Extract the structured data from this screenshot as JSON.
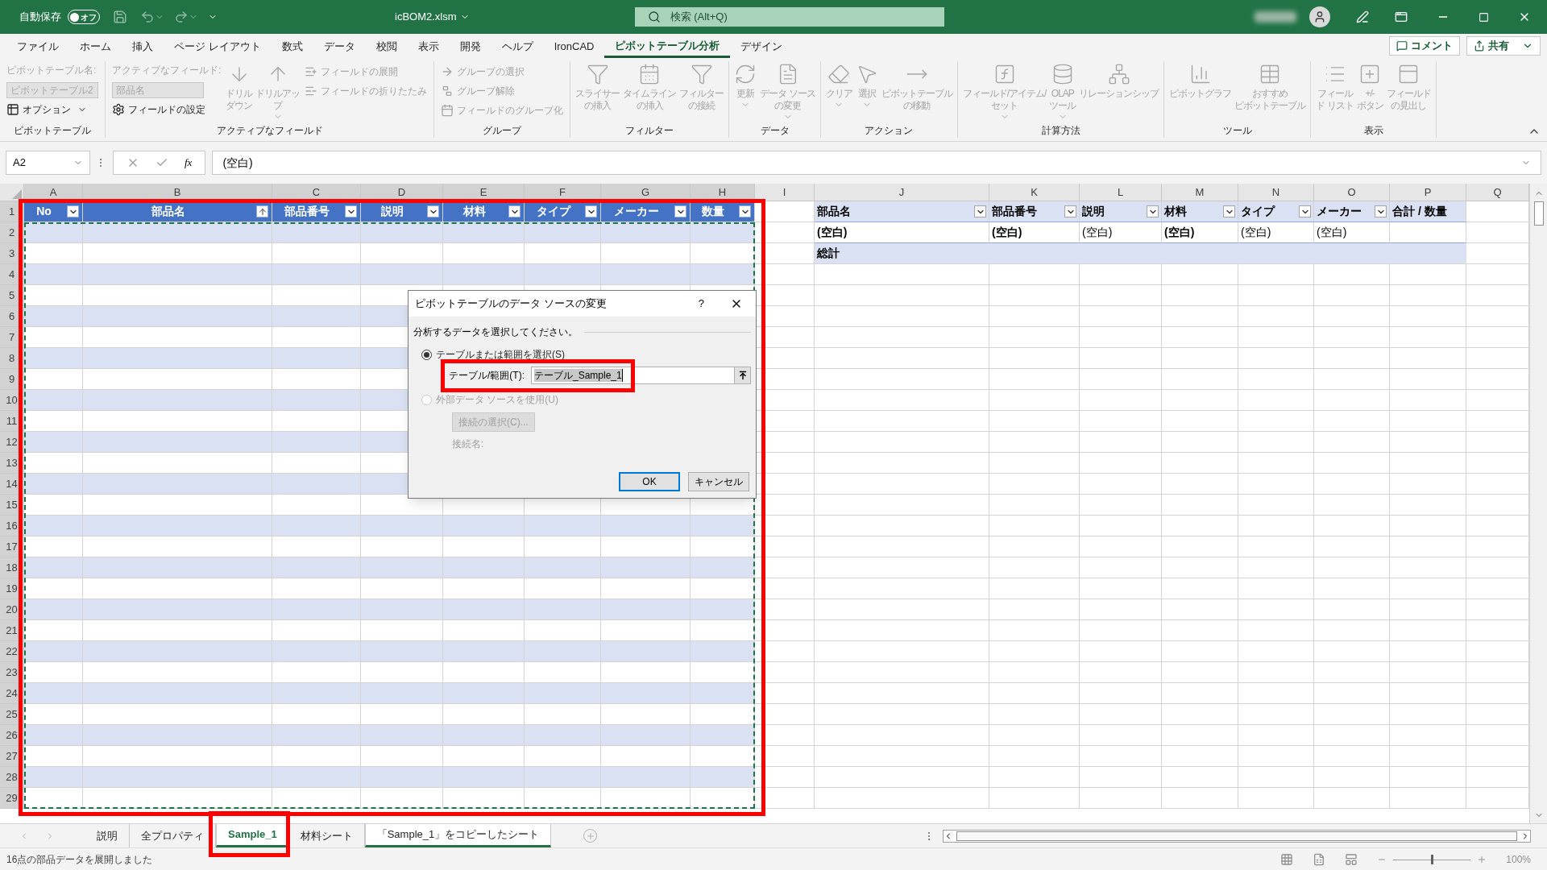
{
  "title_bar": {
    "autosave": {
      "label": "自動保存",
      "on": false,
      "state_text": "オフ"
    },
    "file_name": "icBOM2.xlsm",
    "search": {
      "placeholder": "検索 (Alt+Q)"
    }
  },
  "menu_tabs": [
    {
      "label": "ファイル",
      "selected": false
    },
    {
      "label": "ホーム",
      "selected": false
    },
    {
      "label": "挿入",
      "selected": false
    },
    {
      "label": "ページ レイアウト",
      "selected": false
    },
    {
      "label": "数式",
      "selected": false
    },
    {
      "label": "データ",
      "selected": false
    },
    {
      "label": "校閲",
      "selected": false
    },
    {
      "label": "表示",
      "selected": false
    },
    {
      "label": "開発",
      "selected": false
    },
    {
      "label": "ヘルプ",
      "selected": false
    },
    {
      "label": "IronCAD",
      "selected": false
    },
    {
      "label": "ピボットテーブル分析",
      "selected": true
    },
    {
      "label": "デザイン",
      "selected": false
    }
  ],
  "share_buttons": [
    "コメント",
    "共有"
  ],
  "ribbon": {
    "groups": [
      {
        "label": "ピボットテーブル",
        "columns": [
          {
            "kind": "stack",
            "items": [
              {
                "kind": "caption",
                "text": "ピボットテーブル名:",
                "disabled": true
              },
              {
                "kind": "field",
                "text": "ピボットテーブル2",
                "disabled": true
              },
              {
                "kind": "small",
                "text": "オプション",
                "menu": true,
                "disabled": false
              }
            ]
          }
        ]
      },
      {
        "label": "アクティブなフィールド",
        "columns": [
          {
            "kind": "stack",
            "items": [
              {
                "kind": "caption",
                "text": "アクティブなフィールド:",
                "disabled": true
              },
              {
                "kind": "field",
                "text": "部品名",
                "disabled": true
              },
              {
                "kind": "small",
                "text": "フィールドの設定",
                "menu": false,
                "disabled": false
              }
            ]
          },
          {
            "kind": "large",
            "lines": [
              "ドリル",
              "ダウン"
            ],
            "menu": false,
            "disabled": true
          },
          {
            "kind": "large",
            "lines": [
              "ドリルアッ",
              "プ"
            ],
            "menu": true,
            "disabled": true
          },
          {
            "kind": "stack",
            "items": [
              {
                "kind": "small",
                "text": "フィールドの展開",
                "menu": false,
                "disabled": true
              },
              {
                "kind": "small",
                "text": "フィールドの折りたたみ",
                "menu": false,
                "disabled": true
              }
            ]
          }
        ]
      },
      {
        "label": "グループ",
        "columns": [
          {
            "kind": "stack",
            "items": [
              {
                "kind": "small",
                "text": "グループの選択",
                "menu": false,
                "disabled": true
              },
              {
                "kind": "small",
                "text": "グループ解除",
                "menu": false,
                "disabled": true
              },
              {
                "kind": "small",
                "text": "フィールドのグループ化",
                "menu": false,
                "disabled": true
              }
            ]
          }
        ]
      },
      {
        "label": "フィルター",
        "columns": [
          {
            "kind": "large",
            "lines": [
              "スライサー",
              "の挿入"
            ],
            "menu": false,
            "disabled": true
          },
          {
            "kind": "large",
            "lines": [
              "タイムライン",
              "の挿入"
            ],
            "menu": false,
            "disabled": true
          },
          {
            "kind": "large",
            "lines": [
              "フィルター",
              "の接続"
            ],
            "menu": false,
            "disabled": true
          }
        ]
      },
      {
        "label": "データ",
        "columns": [
          {
            "kind": "large",
            "lines": [
              "更新"
            ],
            "menu": true,
            "disabled": true
          },
          {
            "kind": "large",
            "lines": [
              "データ ソース",
              "の変更"
            ],
            "menu": true,
            "disabled": true
          }
        ]
      },
      {
        "label": "アクション",
        "columns": [
          {
            "kind": "large",
            "lines": [
              "クリア"
            ],
            "menu": true,
            "disabled": true
          },
          {
            "kind": "large",
            "lines": [
              "選択"
            ],
            "menu": true,
            "disabled": true
          },
          {
            "kind": "large",
            "lines": [
              "ピボットテーブル",
              "の移動"
            ],
            "menu": false,
            "disabled": true
          }
        ]
      },
      {
        "label": "計算方法",
        "columns": [
          {
            "kind": "large",
            "lines": [
              "フィールド/アイテム/",
              "セット"
            ],
            "menu": true,
            "disabled": true
          },
          {
            "kind": "large",
            "lines": [
              "OLAP",
              "ツール"
            ],
            "menu": true,
            "disabled": true
          },
          {
            "kind": "large",
            "lines": [
              "リレーションシップ"
            ],
            "menu": false,
            "disabled": true
          }
        ]
      },
      {
        "label": "ツール",
        "columns": [
          {
            "kind": "large",
            "lines": [
              "ピボットグラフ"
            ],
            "menu": false,
            "disabled": true
          },
          {
            "kind": "large",
            "lines": [
              "おすすめ",
              "ピボットテーブル"
            ],
            "menu": false,
            "disabled": true
          }
        ]
      },
      {
        "label": "表示",
        "columns": [
          {
            "kind": "large",
            "lines": [
              "フィール",
              "ド リスト"
            ],
            "menu": false,
            "disabled": true
          },
          {
            "kind": "large",
            "lines": [
              "+/-",
              "ボタン"
            ],
            "menu": false,
            "disabled": true
          },
          {
            "kind": "large",
            "lines": [
              "フィールド",
              "の見出し"
            ],
            "menu": false,
            "disabled": true
          }
        ]
      }
    ]
  },
  "formula_bar": {
    "name_box": "A2",
    "fx": "fx",
    "formula": "(空白)"
  },
  "columns": [
    "A",
    "B",
    "C",
    "D",
    "E",
    "F",
    "G",
    "H",
    "I",
    "J",
    "K",
    "L",
    "M",
    "N",
    "O",
    "P",
    "Q"
  ],
  "row_numbers": [
    "1",
    "2",
    "3",
    "4",
    "5",
    "6",
    "7",
    "8",
    "9",
    "10",
    "11",
    "12",
    "13",
    "14",
    "15",
    "16",
    "17",
    "18",
    "19",
    "20",
    "21",
    "22",
    "23",
    "24",
    "25",
    "26",
    "27",
    "28",
    "29"
  ],
  "table": {
    "headers": [
      {
        "label": "No",
        "sorted": false
      },
      {
        "label": "部品名",
        "sorted": true
      },
      {
        "label": "部品番号",
        "sorted": false
      },
      {
        "label": "説明",
        "sorted": false
      },
      {
        "label": "材料",
        "sorted": false
      },
      {
        "label": "タイプ",
        "sorted": false
      },
      {
        "label": "メーカー",
        "sorted": false
      },
      {
        "label": "数量",
        "sorted": false
      }
    ]
  },
  "pivot": {
    "headers": [
      {
        "label": "部品名",
        "filter": true
      },
      {
        "label": "部品番号",
        "filter": true
      },
      {
        "label": "説明",
        "filter": true
      },
      {
        "label": "材料",
        "filter": true
      },
      {
        "label": "タイプ",
        "filter": true
      },
      {
        "label": "メーカー",
        "filter": true
      },
      {
        "label": "合計 / 数量",
        "filter": false
      }
    ],
    "values": [
      {
        "text": "(空白)",
        "bold": true
      },
      {
        "text": "(空白)",
        "bold": true
      },
      {
        "text": "(空白)",
        "bold": false
      },
      {
        "text": "(空白)",
        "bold": true
      },
      {
        "text": "(空白)",
        "bold": false
      },
      {
        "text": "(空白)",
        "bold": false
      }
    ],
    "total": "総計"
  },
  "dialog": {
    "title": "ピボットテーブルのデータ ソースの変更",
    "help": "?",
    "prompt": "分析するデータを選択してください。",
    "options": [
      {
        "label": "テーブルまたは範囲を選択(S)",
        "selected": true,
        "disabled": false
      },
      {
        "label": "外部データ ソースを使用(U)",
        "selected": false,
        "disabled": true
      }
    ],
    "range_label": "テーブル/範囲(T):",
    "range_value": "テーブル_Sample_1",
    "connection_button": "接続の選択(C)...",
    "connection_label": "接続名:",
    "ok": "OK",
    "cancel": "キャンセル"
  },
  "sheet_tabs": [
    {
      "label": "説明",
      "selected": false,
      "active": false
    },
    {
      "label": "全プロパティ",
      "selected": false,
      "active": false
    },
    {
      "label": "Sample_1",
      "selected": true,
      "active": true
    },
    {
      "label": "材料シート",
      "selected": false,
      "active": false
    },
    {
      "label": "「Sample_1」をコピーしたシート",
      "selected": true,
      "active": false
    }
  ],
  "status_bar": {
    "message": "16点の部品データを展開しました",
    "zoom": {
      "level": 0.5,
      "reading": "100%"
    }
  }
}
